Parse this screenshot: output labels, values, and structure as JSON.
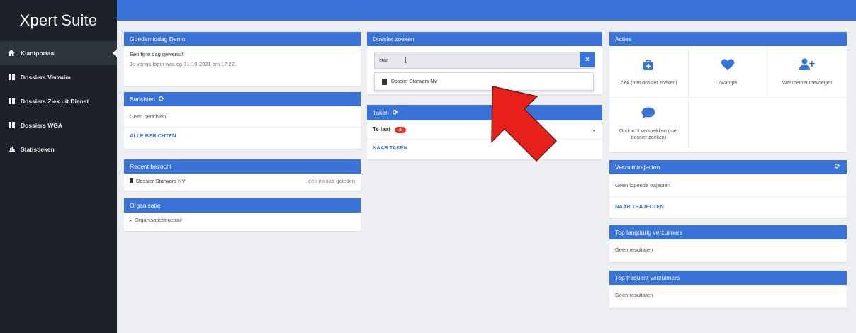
{
  "app": {
    "brand_bold": "Xpert",
    "brand_light": "Suite"
  },
  "sidebar": {
    "items": [
      {
        "label": "Klantportaal",
        "icon": "home-icon"
      },
      {
        "label": "Dossiers Verzuim",
        "icon": "grid-icon"
      },
      {
        "label": "Dossiers Ziek uit Dienst",
        "icon": "grid-icon"
      },
      {
        "label": "Dossiers WGA",
        "icon": "grid-icon"
      },
      {
        "label": "Statistieken",
        "icon": "bar-chart-icon"
      }
    ]
  },
  "welcome": {
    "title": "Goedemiddag Demo",
    "line1": "Een fijne dag gewenst!",
    "line2": "Je vorige login was op 31-10-2021 om 17:22."
  },
  "berichten": {
    "title": "Berichten",
    "empty": "Geen berichten",
    "link": "ALLE BERICHTEN"
  },
  "recent": {
    "title": "Recent bezocht",
    "item": "Dossier Starwars NV",
    "time": "één minuut geleden"
  },
  "organisatie": {
    "title": "Organisatie",
    "item": "Organisatiestructuur"
  },
  "dossier_search": {
    "title": "Dossier zoeken",
    "value": "star",
    "clear": "×",
    "result": "Dossier Starwars NV"
  },
  "taken": {
    "title": "Taken",
    "late_label": "Te laat",
    "late_count": "3",
    "link": "NAAR TAKEN"
  },
  "acties": {
    "title": "Acties",
    "tiles": [
      {
        "label": "Ziek (met dossier zoeken)",
        "icon": "medical-kit-icon"
      },
      {
        "label": "Zwanger",
        "icon": "heart-icon"
      },
      {
        "label": "Werknemer toevoegen",
        "icon": "add-user-icon"
      },
      {
        "label": "Opdracht verstrekken (met dossier zoeken)",
        "icon": "chat-bubble-icon"
      }
    ]
  },
  "verzuimtrajecten": {
    "title": "Verzuimtrajecten",
    "empty": "Geen lopende trajecten",
    "link": "NAAR TRAJECTEN"
  },
  "top_langdurig": {
    "title": "Top langdurig verzuimers",
    "empty": "Geen resultaten"
  },
  "top_frequent": {
    "title": "Top frequent verzuimers",
    "empty": "Geen resultaten"
  },
  "colors": {
    "accent": "#3a73d8",
    "sidebar": "#1d2228",
    "badge": "#d93a2b",
    "arrow": "#e8201a"
  }
}
